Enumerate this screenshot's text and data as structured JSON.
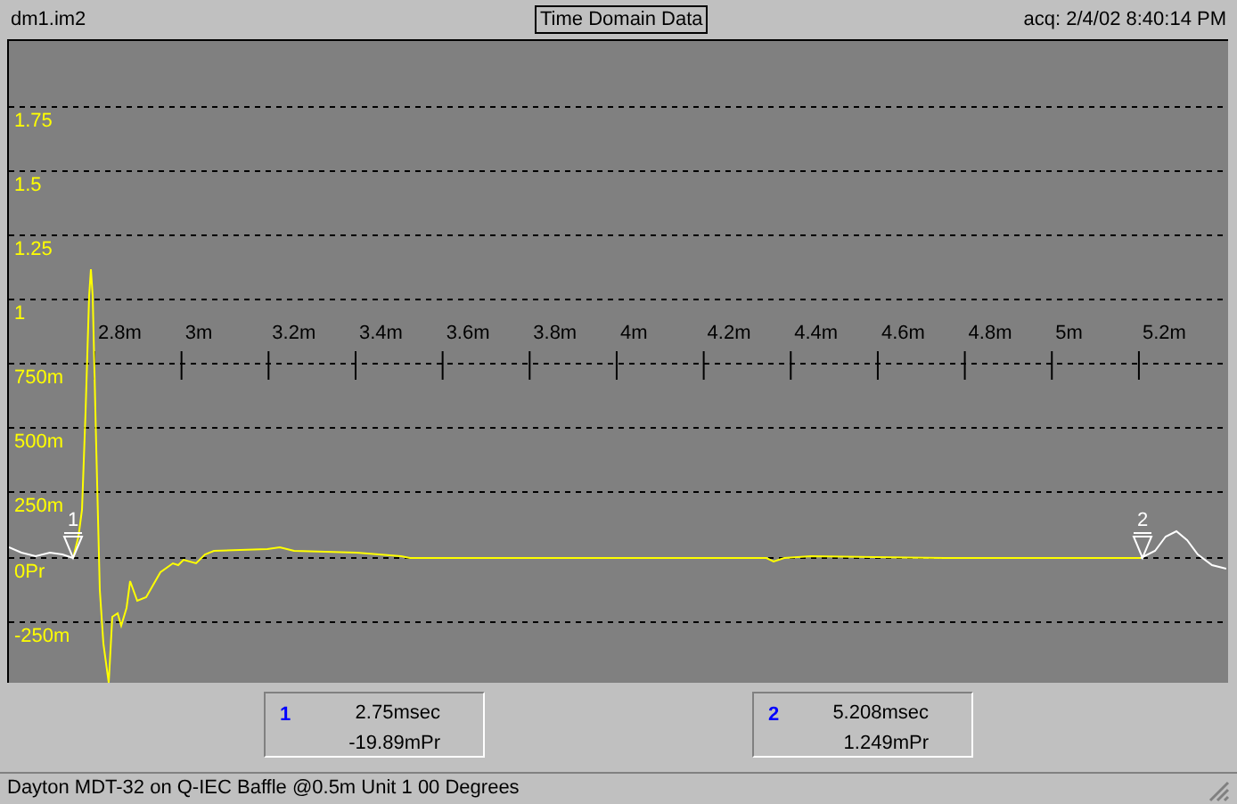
{
  "header": {
    "file": "dm1.im2",
    "title": "Time Domain Data",
    "acquired": "acq: 2/4/02 8:40:14 PM"
  },
  "plot": {
    "y_labels": [
      "1.75",
      "1.5",
      "1.25",
      "1",
      "750m",
      "500m",
      "250m",
      "0Pr",
      "-250m"
    ],
    "x_labels": [
      "2.8m",
      "3m",
      "3.2m",
      "3.4m",
      "3.6m",
      "3.8m",
      "4m",
      "4.2m",
      "4.4m",
      "4.6m",
      "4.8m",
      "5m",
      "5.2m"
    ],
    "cursors": [
      {
        "label": "1"
      },
      {
        "label": "2"
      }
    ]
  },
  "readouts": [
    {
      "index": "1",
      "time": "2.75msec",
      "value": "-19.89mPr"
    },
    {
      "index": "2",
      "time": "5.208msec",
      "value": "1.249mPr"
    }
  ],
  "status_bar": {
    "text": "Dayton MDT-32 on Q-IEC Baffle @0.5m Unit 1 00 Degrees"
  }
}
